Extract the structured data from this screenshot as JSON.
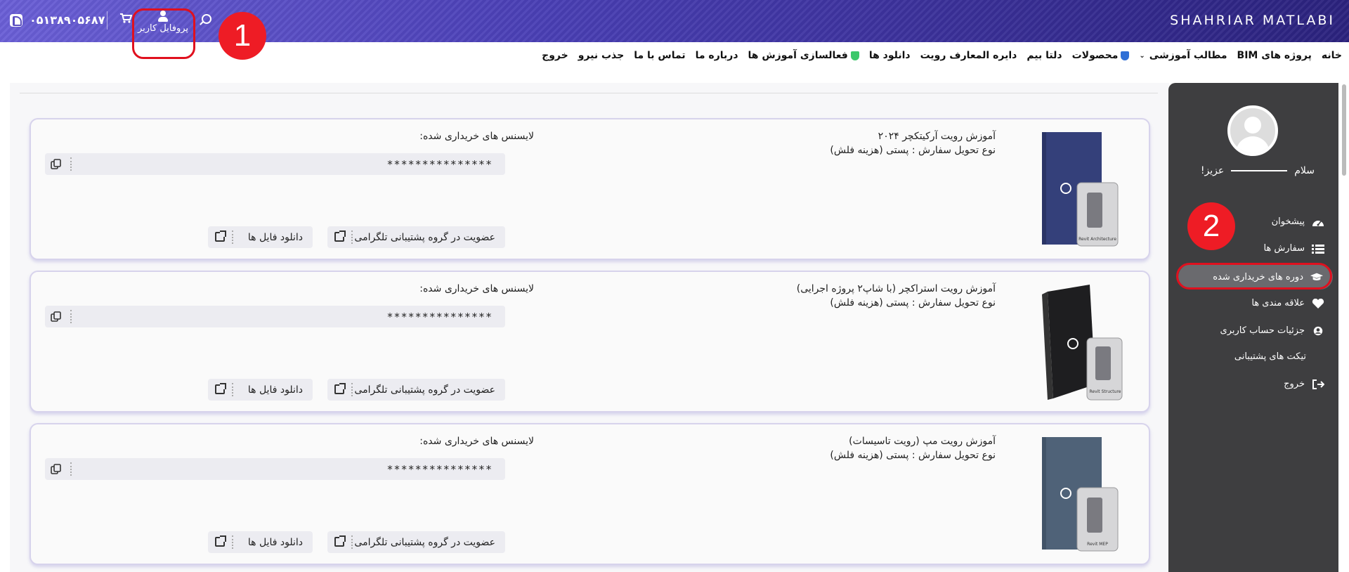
{
  "header": {
    "phone": "۰۵۱۳۸۹۰۵۶۸۷",
    "profile_label": "پروفایل کاربر",
    "logo": "SHAHRIAR MATLABI"
  },
  "annotations": {
    "one": "1",
    "two": "2"
  },
  "nav": {
    "items": [
      "خانه",
      "پروژه های BIM",
      "مطالب آموزشی",
      "محصولات",
      "دلتا بیم",
      "دایره المعارف رویت",
      "دانلود ها",
      "فعالسازی آموزش ها",
      "درباره ما",
      "تماس با ما",
      "جذب نیرو",
      "خروج"
    ]
  },
  "courses": [
    {
      "title": "آموزش رویت آرکیتکچر ۲۰۲۴",
      "shipping": "نوع تحویل سفارش : پستی (هزینه فلش)",
      "license_label": "لایسنس های خریداری شده:",
      "license": "***************",
      "telegram_btn": "عضویت در گروه پشتیبانی تلگرامی",
      "download_btn": "دانلود فایل ها",
      "box_text": "Revit Architecture"
    },
    {
      "title": "آموزش رویت استراکچر (با شاپ۲ پروژه اجرایی)",
      "shipping": "نوع تحویل سفارش : پستی (هزینه فلش)",
      "license_label": "لایسنس های خریداری شده:",
      "license": "***************",
      "telegram_btn": "عضویت در گروه پشتیبانی تلگرامی",
      "download_btn": "دانلود فایل ها",
      "box_text": "Revit Structure"
    },
    {
      "title": "آموزش رویت مپ (رویت تاسیسات)",
      "shipping": "نوع تحویل سفارش : پستی (هزینه فلش)",
      "license_label": "لایسنس های خریداری شده:",
      "license": "***************",
      "telegram_btn": "عضویت در گروه پشتیبانی تلگرامی",
      "download_btn": "دانلود فایل ها",
      "box_text": "Revit MEP"
    }
  ],
  "sidebar": {
    "greeting": "سلام",
    "name_suffix": "عزیز!",
    "items": [
      "پیشخوان",
      "سفارش ها",
      "دوره های خریداری شده",
      "علاقه مندی ها",
      "جزئیات حساب کاربری",
      "تیکت های پشتیبانی",
      "خروج"
    ]
  },
  "colors": {
    "accent_red": "#ee1c25",
    "header_start": "#6a5fd6",
    "header_end": "#2b227e",
    "sidebar_bg": "#3e3e40"
  }
}
